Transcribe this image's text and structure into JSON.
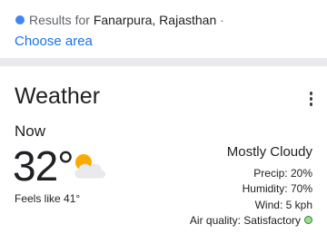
{
  "location": {
    "prefix": "Results for ",
    "place": "Fanarpura, Rajasthan",
    "separator": "·",
    "choose_area": "Choose area"
  },
  "weather": {
    "title": "Weather",
    "period": "Now",
    "temperature": "32°",
    "feels_like": "Feels like 41°",
    "condition": "Mostly Cloudy",
    "icon": "partly-cloudy-icon",
    "details": [
      {
        "label": "Precip:",
        "value": "20%"
      },
      {
        "label": "Humidity:",
        "value": "70%"
      },
      {
        "label": "Wind:",
        "value": "5 kph"
      }
    ],
    "air_quality": {
      "label": "Air quality:",
      "value": "Satisfactory"
    }
  },
  "colors": {
    "link": "#1a73e8",
    "location_dot": "#4285f4",
    "air_quality_good": "#a8d98a",
    "sun": "#f9ab00",
    "cloud": "#e8eaed"
  }
}
